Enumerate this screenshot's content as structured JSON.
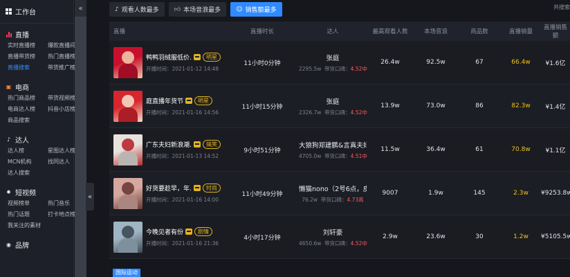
{
  "sidebar": {
    "workbench": "工作台",
    "collapse_top": "«",
    "toggle": "«",
    "sections": [
      {
        "title": "直播",
        "icon": "bar-chart-icon",
        "items": [
          "实时直播榜",
          "爆款直播间",
          "直播带货榜",
          "热门直播榜",
          "直播搜索",
          "带货推广榜"
        ],
        "active": 4
      },
      {
        "title": "电商",
        "icon": "shop-icon",
        "items": [
          "热门商品榜",
          "带货视频榜",
          "电商达人榜",
          "抖音小店榜",
          "商品搜索"
        ]
      },
      {
        "title": "达人",
        "icon": "tiktok-icon",
        "items": [
          "达人榜",
          "星图达人榜",
          "MCN机构",
          "找同达人",
          "达人搜索"
        ]
      },
      {
        "title": "短视频",
        "icon": "flame-icon",
        "items": [
          "视频榜单",
          "热门音乐",
          "热门话题",
          "打卡地点榜",
          "我关注的素材"
        ]
      },
      {
        "title": "品牌",
        "icon": "brand-icon",
        "items": []
      }
    ]
  },
  "tabs": [
    {
      "label": "观看人数最多",
      "icon": "music-icon"
    },
    {
      "label": "本场音浪最多",
      "icon": "thumb-icon"
    },
    {
      "label": "销售额最多",
      "icon": "users-icon"
    }
  ],
  "total_label": "共搜索",
  "table": {
    "headers": [
      "直播",
      "直播时长",
      "达人",
      "最高观看人数",
      "本场音浪",
      "商品数",
      "直播销量",
      "直播销售额"
    ],
    "rows": [
      {
        "title": "鸭鸭羽绒服低价...",
        "tag": "明星",
        "time": "开播时间：2021-01-12 14:48",
        "duration": "11小时0分钟",
        "star": "张庭",
        "fans": "2295.5w",
        "rep_label": "带货口碑：",
        "rate": "4.52",
        "level": "中",
        "views": "26.4w",
        "wave": "92.5w",
        "goods": "67",
        "volume": "66.4w",
        "amount": "¥1.6亿",
        "thumb": [
          "#c8102e",
          "#f0c7a8"
        ]
      },
      {
        "title": "庭直播年货节",
        "tag": "明星",
        "time": "开播时间：2021-01-16 14:56",
        "duration": "11小时15分钟",
        "star": "张庭",
        "fans": "2326.7w",
        "rep_label": "带货口碑：",
        "rate": "4.52",
        "level": "中",
        "views": "13.9w",
        "wave": "73.0w",
        "goods": "86",
        "volume": "82.3w",
        "amount": "¥1.4亿",
        "thumb": [
          "#d7262e",
          "#f6d9c5"
        ]
      },
      {
        "title": "广东夫妇新浪潮...",
        "tag": "搞笑",
        "time": "开播时间：2021-01-13 14:52",
        "duration": "9小时51分钟",
        "star": "大狼狗郑建鹏&言真夫妇",
        "fans": "4705.0w",
        "rep_label": "带货口碑：",
        "rate": "4.51",
        "level": "中",
        "views": "11.5w",
        "wave": "36.4w",
        "goods": "61",
        "volume": "70.8w",
        "amount": "¥1.1亿",
        "thumb": [
          "#e8e2dc",
          "#b8282d"
        ]
      },
      {
        "title": "好货要趁早，年...",
        "tag": "时尚",
        "time": "开播时间：2021-01-16 14:00",
        "duration": "11小时49分钟",
        "star": "懒猫nono（2号6点，皮草嘉...",
        "fans": "76.2w",
        "rep_label": "带货口碑：",
        "rate": "4.73",
        "level": "高",
        "views": "9007",
        "wave": "1.9w",
        "goods": "145",
        "volume": "2.3w",
        "amount": "¥9253.8w",
        "thumb": [
          "#d6a8a0",
          "#6b3a34"
        ]
      },
      {
        "title": "今晚见者有份",
        "tag": "剧情",
        "time": "开播时间：2021-01-16 21:36",
        "duration": "4小时17分钟",
        "star": "刘轩豪",
        "fans": "4650.6w",
        "rep_label": "带货口碑：",
        "rate": "4.52",
        "level": "中",
        "views": "2.9w",
        "wave": "23.6w",
        "goods": "30",
        "volume": "1.2w",
        "amount": "¥5105.5w",
        "thumb": [
          "#9fb4c4",
          "#3e4a55"
        ]
      }
    ],
    "partial_badge": "国际运动"
  }
}
